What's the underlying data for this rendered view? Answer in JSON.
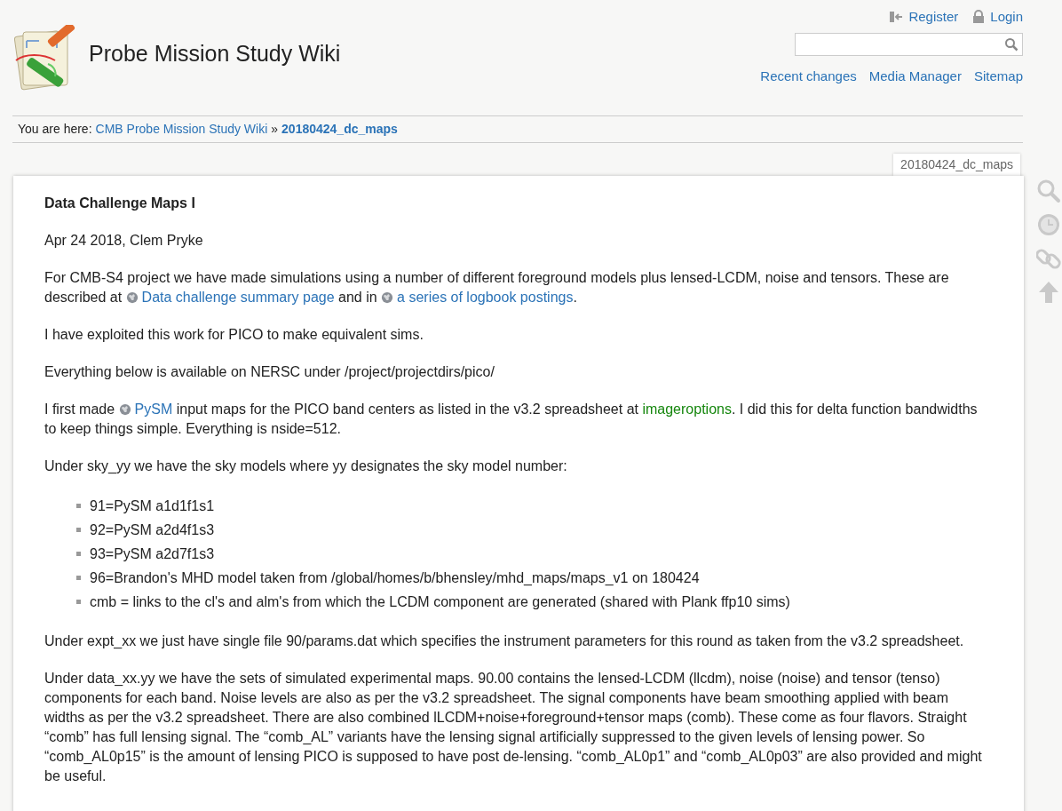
{
  "header": {
    "title": "Probe Mission Study Wiki",
    "user_links": [
      {
        "kind": "register",
        "label": "Register"
      },
      {
        "kind": "login",
        "label": "Login"
      }
    ],
    "site_links": [
      "Recent changes",
      "Media Manager",
      "Sitemap"
    ]
  },
  "breadcrumb": {
    "label": "You are here:",
    "items": [
      {
        "label": "CMB Probe Mission Study Wiki",
        "current": false
      },
      {
        "label": "20180424_dc_maps",
        "current": true
      }
    ],
    "separator": "»"
  },
  "page_tab": "20180424_dc_maps",
  "content": [
    {
      "kind": "heading",
      "parts": [
        {
          "text": "Data Challenge Maps I"
        }
      ]
    },
    {
      "kind": "paragraph",
      "parts": [
        {
          "text": "Apr 24 2018, Clem Pryke"
        }
      ]
    },
    {
      "kind": "paragraph",
      "parts": [
        {
          "text": "For CMB-S4 project we have made simulations using a number of different foreground models plus lensed-LCDM, noise and tensors. These are described at "
        },
        {
          "link": "Data challenge summary page",
          "kind": "external"
        },
        {
          "text": " and in "
        },
        {
          "link": "a series of logbook postings",
          "kind": "external"
        },
        {
          "text": "."
        }
      ]
    },
    {
      "kind": "paragraph",
      "parts": [
        {
          "text": "I have exploited this work for PICO to make equivalent sims."
        }
      ]
    },
    {
      "kind": "paragraph",
      "parts": [
        {
          "text": "Everything below is available on NERSC under /project/projectdirs/pico/"
        }
      ]
    },
    {
      "kind": "paragraph",
      "parts": [
        {
          "text": "I first made "
        },
        {
          "link": "PySM",
          "kind": "external"
        },
        {
          "text": " input maps for the PICO band centers as listed in the v3.2 spreadsheet at "
        },
        {
          "link": "imageroptions",
          "kind": "internal"
        },
        {
          "text": ". I did this for delta function bandwidths to keep things simple. Everything is nside=512."
        }
      ]
    },
    {
      "kind": "paragraph",
      "parts": [
        {
          "text": "Under sky_yy we have the sky models where yy designates the sky model number:"
        }
      ]
    },
    {
      "kind": "list",
      "items": [
        "91=PySM a1d1f1s1",
        "92=PySM a2d4f1s3",
        "93=PySM a2d7f1s3",
        "96=Brandon's MHD model taken from /global/homes/b/bhensley/mhd_maps/maps_v1 on 180424",
        "cmb = links to the cl's and alm's from which the LCDM component are generated (shared with Plank ffp10 sims)"
      ]
    },
    {
      "kind": "paragraph",
      "parts": [
        {
          "text": "Under expt_xx we just have single file 90/params.dat which specifies the instrument parameters for this round as taken from the v3.2 spreadsheet."
        }
      ]
    },
    {
      "kind": "paragraph",
      "parts": [
        {
          "text": "Under data_xx.yy we have the sets of simulated experimental maps. 90.00 contains the lensed-LCDM (llcdm), noise (noise) and tensor (tenso) components for each band. Noise levels are also as per the v3.2 spreadsheet. The signal components have beam smoothing applied with beam widths as per the v3.2 spreadsheet. There are also combined lLCDM+noise+foreground+tensor maps (comb). These come as four flavors. Straight “comb” has full lensing signal. The “comb_AL” variants have the lensing signal artificially suppressed to the given levels of lensing power. So “comb_AL0p15” is the amount of lensing PICO is supposed to have post de-lensing. “comb_AL0p1” and “comb_AL0p03” are also provided and might be useful."
        }
      ]
    }
  ],
  "tools": [
    {
      "kind": "search"
    },
    {
      "kind": "revisions"
    },
    {
      "kind": "backlinks"
    },
    {
      "kind": "top"
    }
  ]
}
